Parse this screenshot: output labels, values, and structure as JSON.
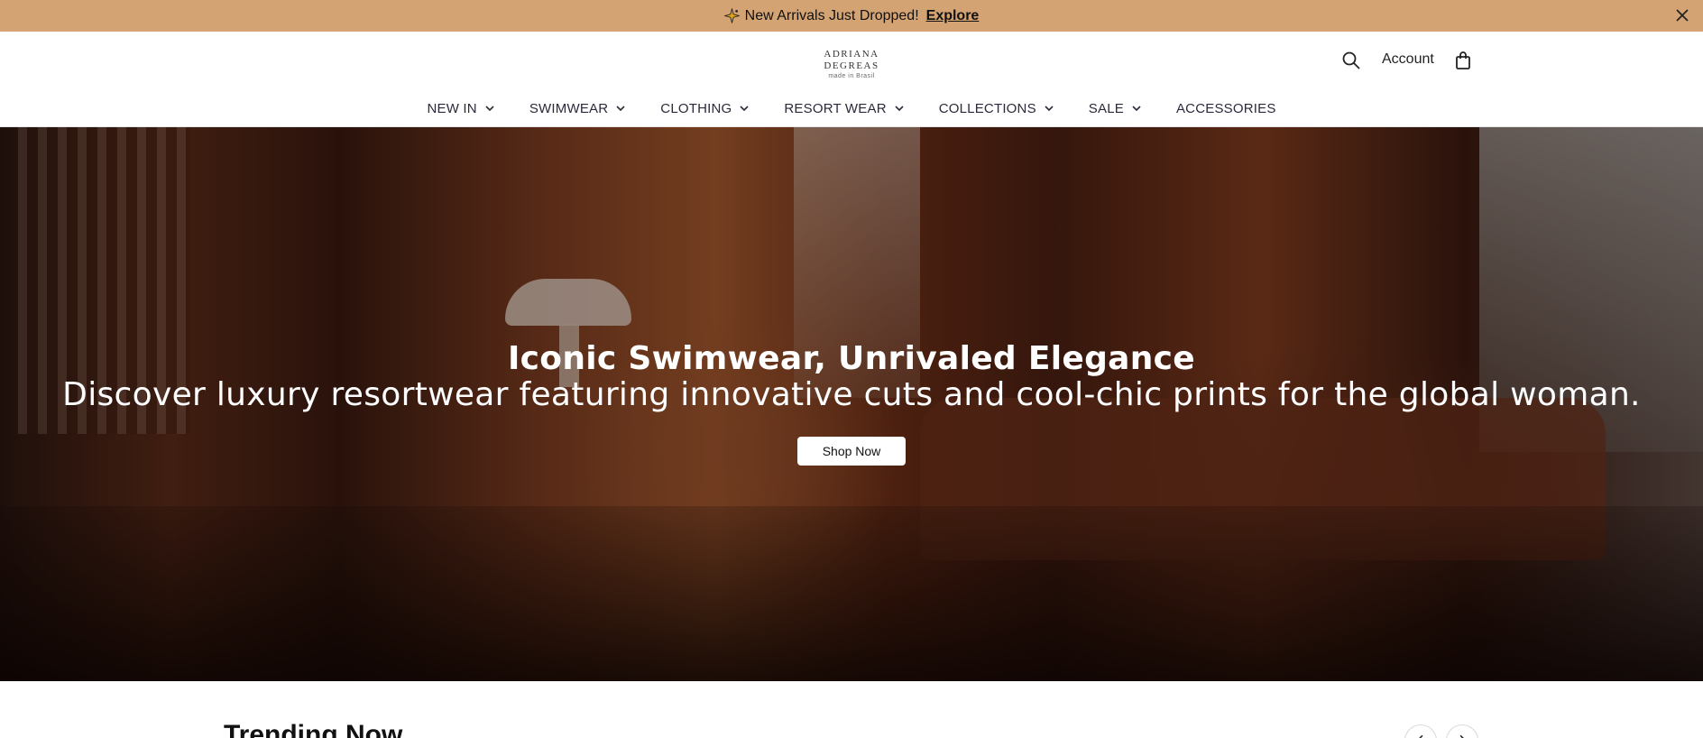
{
  "announcement": {
    "message": "New Arrivals Just Dropped!",
    "link_label": "Explore",
    "background_color": "#d4a373"
  },
  "header": {
    "logo": {
      "brand": "ADRIANA DEGREAS",
      "tagline": "made in Brasil"
    },
    "account_label": "Account",
    "icons": [
      "search-icon",
      "shopping-bag-icon"
    ]
  },
  "nav": {
    "items": [
      {
        "label": "NEW IN",
        "has_dropdown": true
      },
      {
        "label": "SWIMWEAR",
        "has_dropdown": true
      },
      {
        "label": "CLOTHING",
        "has_dropdown": true
      },
      {
        "label": "RESORT WEAR",
        "has_dropdown": true
      },
      {
        "label": "COLLECTIONS",
        "has_dropdown": true
      },
      {
        "label": "SALE",
        "has_dropdown": true
      },
      {
        "label": "ACCESSORIES",
        "has_dropdown": false
      }
    ]
  },
  "hero": {
    "title": "Iconic Swimwear, Unrivaled Elegance",
    "subtitle": "Discover luxury resortwear featuring innovative cuts and cool-chic prints for the global woman.",
    "cta_label": "Shop Now"
  },
  "trending": {
    "title": "Trending Now"
  }
}
